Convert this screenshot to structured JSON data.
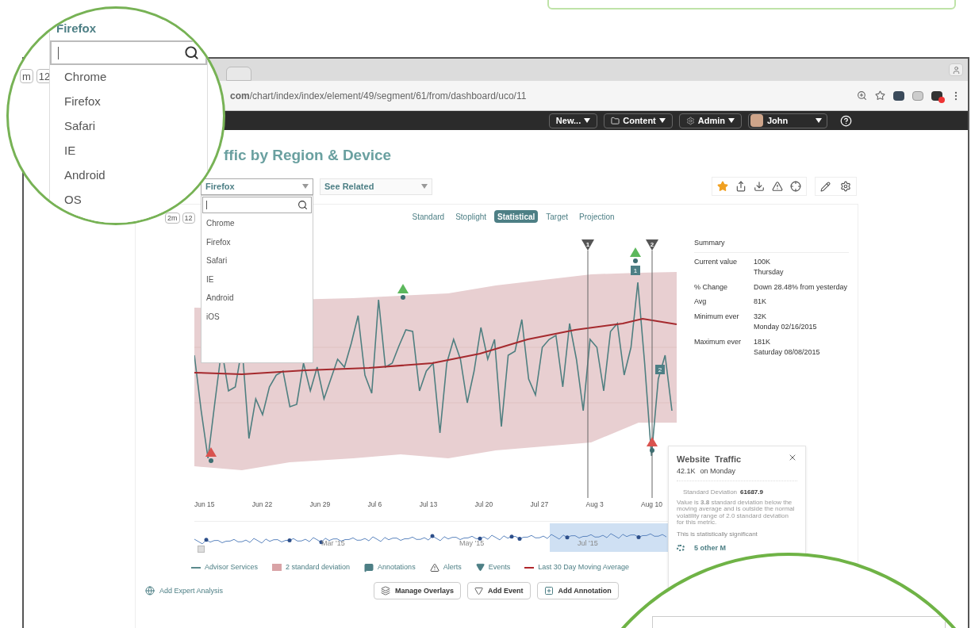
{
  "magnifier": {
    "chips": [
      "m",
      "12"
    ],
    "select_value": "Firefox",
    "options": [
      "Chrome",
      "Firefox",
      "Safari",
      "IE",
      "Android",
      "OS"
    ]
  },
  "browser": {
    "url_host": "com",
    "url_path": "/chart/index/index/element/49/segment/61/from/dashboard/uco/11"
  },
  "nav": {
    "buttons": [
      {
        "kind": "plain",
        "label": "New..."
      },
      {
        "kind": "folder",
        "label": "Content"
      },
      {
        "kind": "gear",
        "label": "Admin"
      }
    ],
    "user": "John"
  },
  "title": "ffic by Region & Device",
  "filters": [
    {
      "value": "Firefox",
      "expanded": true
    },
    {
      "value": "See Related",
      "expanded": false
    }
  ],
  "dropdown": {
    "options": [
      "Chrome",
      "Firefox",
      "Safari",
      "IE",
      "Android",
      "iOS"
    ]
  },
  "favorite": true,
  "range_chips": [
    "2m",
    "12"
  ],
  "view_tabs": [
    {
      "label": "Standard",
      "selected": false
    },
    {
      "label": "Stoplight",
      "selected": false
    },
    {
      "label": "Statistical",
      "selected": true
    },
    {
      "label": "Target",
      "selected": false
    },
    {
      "label": "Projection",
      "selected": false
    }
  ],
  "chart": {
    "x_labels": [
      "Jun 15",
      "Jun 22",
      "Jun 29",
      "Jul 6",
      "Jul 13",
      "Jul 20",
      "Jul 27",
      "Aug 3",
      "Aug 10"
    ],
    "events": [
      "1",
      "2"
    ],
    "annotations": [
      "1",
      "2"
    ]
  },
  "summary": {
    "title": "Summary",
    "rows": [
      {
        "label": "Current value",
        "value": "100K",
        "detail": "Thursday"
      },
      {
        "label": "% Change",
        "value": "Down 28.48% from yesterday"
      },
      {
        "label": "Avg",
        "value": "81K"
      },
      {
        "label": "Minimum ever",
        "value": "32K",
        "detail": "Monday 02/16/2015"
      },
      {
        "label": "Maximum ever",
        "value": "181K",
        "detail": "Saturday 08/08/2015"
      }
    ]
  },
  "navigator": {
    "labels": [
      "Mar '15",
      "May '15",
      "Jul '15"
    ]
  },
  "legend": [
    {
      "kind": "line",
      "label": "Advisor Services",
      "color": "#5b8a8c"
    },
    {
      "kind": "band",
      "label": "2 standard deviation",
      "color": "#d9a3a6"
    },
    {
      "kind": "annotation",
      "label": "Annotations"
    },
    {
      "kind": "alert",
      "label": "Alerts"
    },
    {
      "kind": "event",
      "label": "Events"
    },
    {
      "kind": "line",
      "label": "Last 30 Day Moving Average",
      "color": "#b0262b"
    }
  ],
  "expert": "Add Expert Analysis",
  "actions": [
    {
      "kind": "overlays",
      "label": "Manage Overlays"
    },
    {
      "kind": "event",
      "label": "Add Event"
    },
    {
      "kind": "annotation",
      "label": "Add Annotation"
    }
  ],
  "tooltip": {
    "title": "Website  Traffic",
    "value": "42.1K",
    "day": "on Monday",
    "sd_label": "Standard Deviation",
    "sd_value": "61687.9",
    "body": "Value is **3.8** standard deviation below the moving average and is outside the normal volatility range of 2.0 standard deviation for this metric.",
    "note": "This is statistically significant",
    "more": "5 other M"
  }
}
